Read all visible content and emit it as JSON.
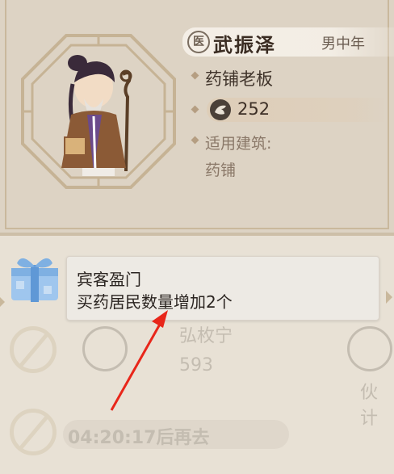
{
  "character": {
    "badge": "医",
    "name": "武振泽",
    "type": "男中年",
    "role": "药铺老板",
    "stat_value": "252",
    "applies_label": "适用建筑:",
    "applies_value": "药铺"
  },
  "tooltip": {
    "title": "宾客盈门",
    "description": "买药居民数量增加2个"
  },
  "background_list": {
    "row1_name": "弘枚宁",
    "row1_value": "593",
    "row1_right_label": "伙计",
    "row2_timer": "04:20:17后再去"
  },
  "colors": {
    "annotation_arrow": "#e8261a",
    "panel": "#ddd3c4",
    "background": "#e8e1d5"
  },
  "icons": [
    "clinic-badge-icon",
    "stat-icon",
    "gift-box-icon",
    "forbidden-icon",
    "annotation-arrow"
  ]
}
